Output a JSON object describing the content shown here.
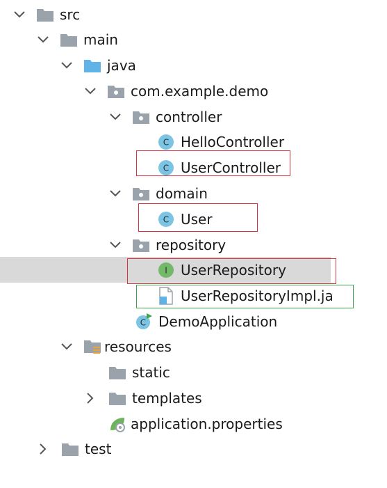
{
  "tree": {
    "src": "src",
    "main": "main",
    "java": "java",
    "package": "com.example.demo",
    "controller": "controller",
    "hello_controller": "HelloController",
    "user_controller": "UserController",
    "domain": "domain",
    "user": "User",
    "repository": "repository",
    "user_repository": "UserRepository",
    "user_repository_impl": "UserRepositoryImpl.ja",
    "demo_application": "DemoApplication",
    "resources": "resources",
    "static": "static",
    "templates": "templates",
    "app_properties": "application.properties",
    "test": "test"
  },
  "icon_glyphs": {
    "class": "C",
    "interface": "I"
  },
  "colors": {
    "folder": "#9aa3ab",
    "source_folder": "#5fb3e6",
    "class_badge": "#7cc4e4",
    "interface_badge": "#74b86a",
    "highlight_red": "#d9333f",
    "highlight_green": "#3aa64a",
    "selection": "#d9d9d9"
  }
}
